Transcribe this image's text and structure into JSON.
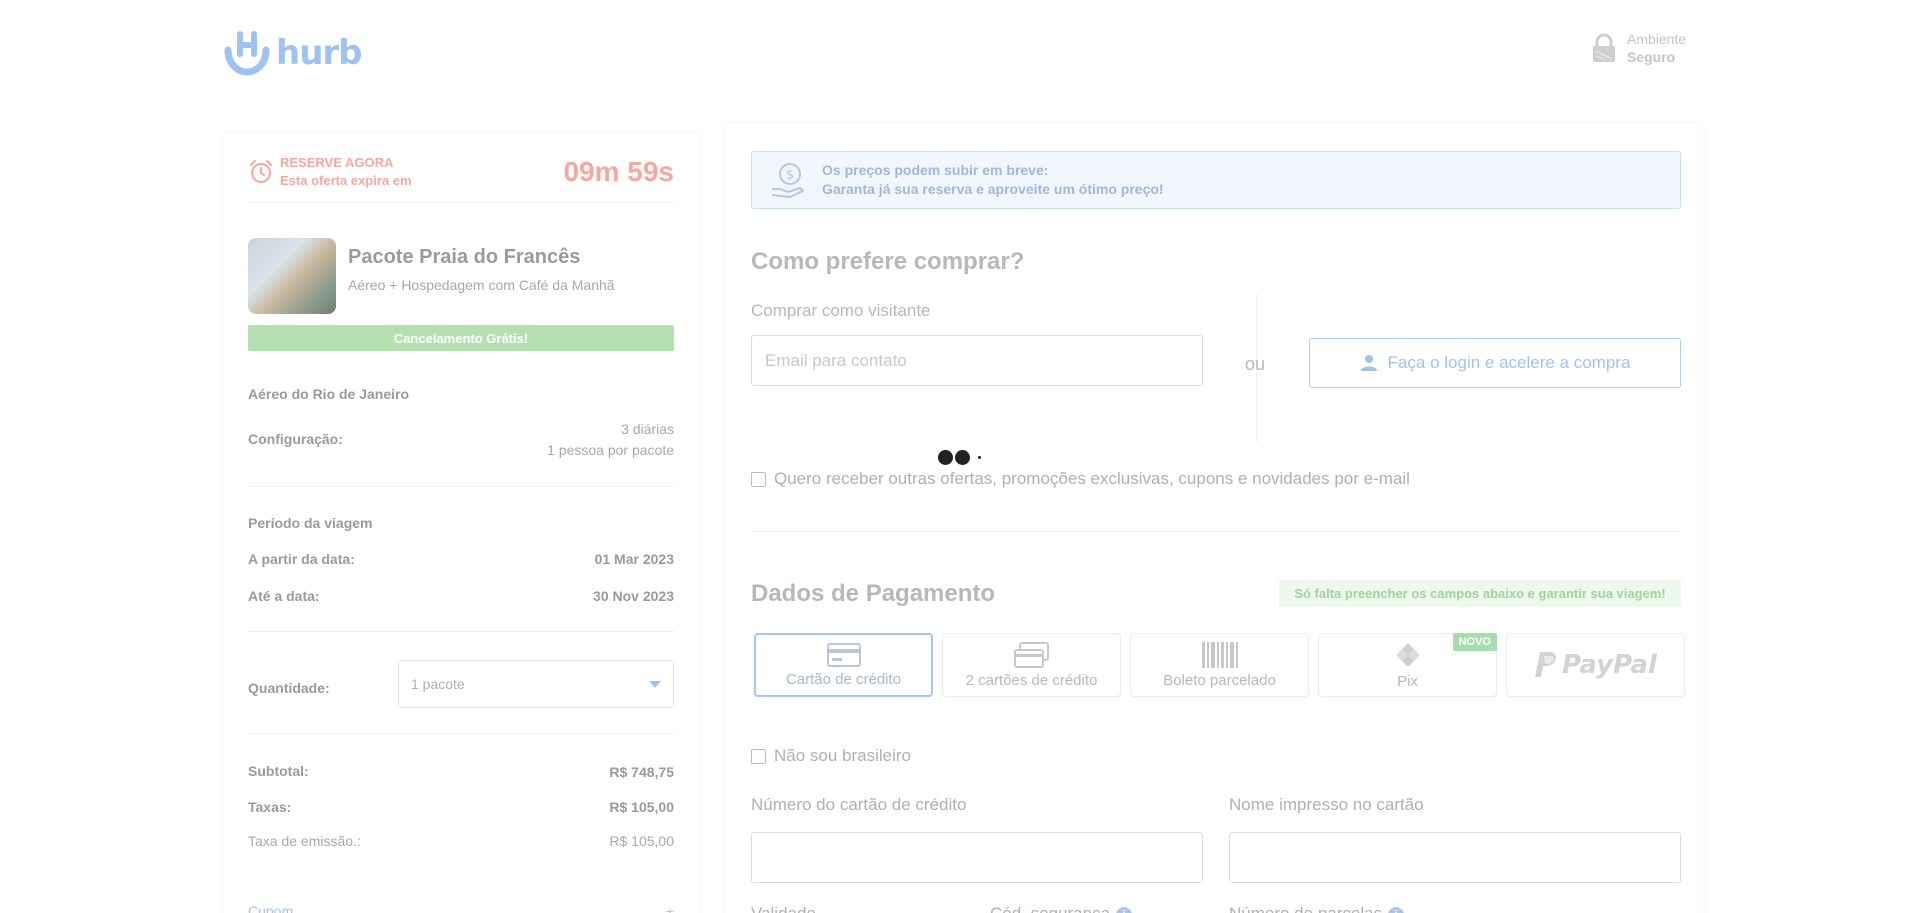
{
  "header": {
    "brand": "hurb",
    "secure_line1": "Ambiente",
    "secure_line2": "Seguro"
  },
  "sidebar": {
    "timer_title": "RESERVE AGORA",
    "timer_sub": "Esta oferta expira em",
    "timer_value": "09m 59s",
    "package_title": "Pacote Praia do Francês",
    "package_sub": "Aéreo + Hospedagem com Café da Manhã",
    "cancel_badge": "Cancelamento Grátis!",
    "flight": "Aéreo do Rio de Janeiro",
    "config_label": "Configuração:",
    "config_value_1": "3 diárias",
    "config_value_2": "1 pessoa por pacote",
    "period_title": "Período da viagem",
    "from_label": "A partir da data:",
    "from_value": "01 Mar 2023",
    "to_label": "Até a data:",
    "to_value": "30 Nov 2023",
    "qty_label": "Quantidade:",
    "qty_value": "1 pacote",
    "subtotal_label": "Subtotal:",
    "subtotal_value": "R$ 748,75",
    "taxes_label": "Taxas:",
    "taxes_value": "R$ 105,00",
    "emission_label": "Taxa de emissão.:",
    "emission_value": "R$ 105,00",
    "coupon_label": "Cupom",
    "coupon_toggle": "+"
  },
  "main": {
    "notice_line1": "Os preços podem subir em breve:",
    "notice_line2": "Garanta já sua reserva e aproveite um ótimo preço!",
    "buy_title": "Como prefere comprar?",
    "visitor_label": "Comprar como visitante",
    "email_placeholder": "Email para contato",
    "or_label": "ou",
    "login_button": "Faça o login e acelere a compra",
    "newsletter_label": "Quero receber outras ofertas, promoções exclusivas, cupons e novidades por e-mail",
    "payment_title": "Dados de Pagamento",
    "payment_hint": "Só falta preencher os campos abaixo e garantir sua viagem!",
    "payment_options": [
      {
        "label": "Cartão de crédito",
        "icon": "credit-card-icon"
      },
      {
        "label": "2 cartões de crédito",
        "icon": "two-cards-icon"
      },
      {
        "label": "Boleto parcelado",
        "icon": "barcode-icon"
      },
      {
        "label": "Pix",
        "icon": "pix-icon",
        "badge": "NOVO"
      },
      {
        "label": "PayPal",
        "icon": "paypal-logo"
      }
    ],
    "foreigner_label": "Não sou brasileiro",
    "card_number_label": "Número do cartão de crédito",
    "card_name_label": "Nome impresso no cartão",
    "validity_label": "Validade",
    "security_code_label": "Cód. segurança",
    "installments_label": "Número de parcelas"
  }
}
